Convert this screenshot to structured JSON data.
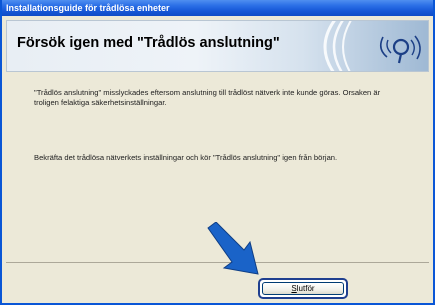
{
  "window": {
    "title": "Installationsguide för trådlösa enheter"
  },
  "header": {
    "title": "Försök igen med \"Trådlös anslutning\""
  },
  "content": {
    "paragraph_1": "\"Trådlös anslutning\" misslyckades eftersom anslutning till trådlöst nätverk inte kunde göras. Orsaken är troligen felaktiga säkerhetsinställningar.",
    "paragraph_2": "Bekräfta det trådlösa nätverkets inställningar och kör \"Trådlös anslutning\" igen från början."
  },
  "footer": {
    "finish_button": {
      "label_underlined": "S",
      "label_rest": "lutför"
    }
  },
  "colors": {
    "titlebar_blue": "#1657d6",
    "arrow_blue": "#1a63c8",
    "button_highlight": "#1f3f8f"
  },
  "icons": {
    "header_icon": "wireless-signal-icon",
    "pointer_arrow": "arrow-pointer-icon"
  }
}
